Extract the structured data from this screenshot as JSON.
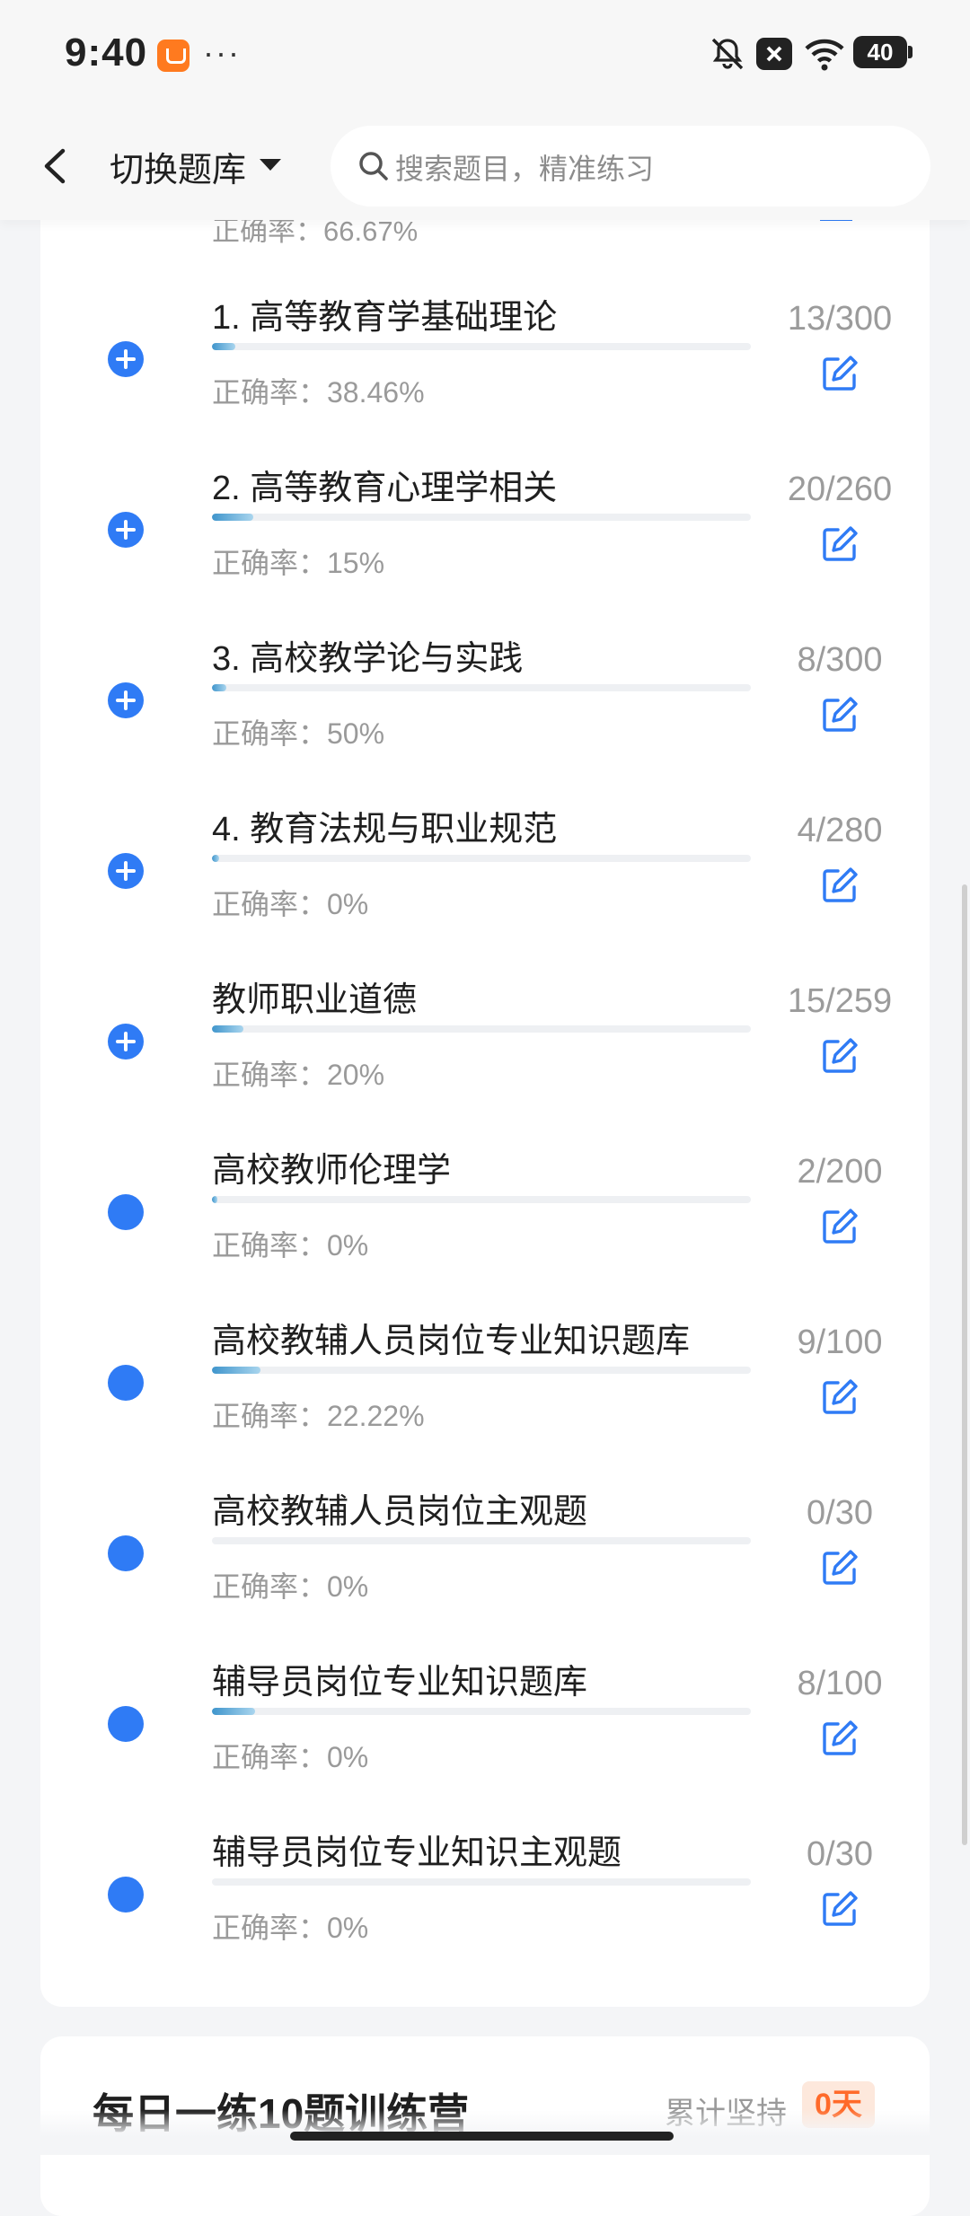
{
  "status": {
    "time": "9:40",
    "battery": "40"
  },
  "nav": {
    "switch_label": "切换题库",
    "search_placeholder": "搜索题目，精准练习"
  },
  "peek": {
    "accuracy_text": "正确率：66.67%"
  },
  "items": [
    {
      "title": "1. 高等教育学基础理论",
      "accuracy": "正确率：38.46%",
      "count": "13/300",
      "progress": 0.043,
      "icon": "plus"
    },
    {
      "title": "2. 高等教育心理学相关",
      "accuracy": "正确率：15%",
      "count": "20/260",
      "progress": 0.077,
      "icon": "plus"
    },
    {
      "title": "3. 高校教学论与实践",
      "accuracy": "正确率：50%",
      "count": "8/300",
      "progress": 0.027,
      "icon": "plus"
    },
    {
      "title": "4. 教育法规与职业规范",
      "accuracy": "正确率：0%",
      "count": "4/280",
      "progress": 0.014,
      "icon": "plus"
    },
    {
      "title": "教师职业道德",
      "accuracy": "正确率：20%",
      "count": "15/259",
      "progress": 0.058,
      "icon": "plus"
    },
    {
      "title": "高校教师伦理学",
      "accuracy": "正确率：0%",
      "count": "2/200",
      "progress": 0.01,
      "icon": "dot"
    },
    {
      "title": "高校教辅人员岗位专业知识题库",
      "accuracy": "正确率：22.22%",
      "count": "9/100",
      "progress": 0.09,
      "icon": "dot"
    },
    {
      "title": "高校教辅人员岗位主观题",
      "accuracy": "正确率：0%",
      "count": "0/30",
      "progress": 0.0,
      "icon": "dot"
    },
    {
      "title": "辅导员岗位专业知识题库",
      "accuracy": "正确率：0%",
      "count": "8/100",
      "progress": 0.08,
      "icon": "dot"
    },
    {
      "title": "辅导员岗位专业知识主观题",
      "accuracy": "正确率：0%",
      "count": "0/30",
      "progress": 0.0,
      "icon": "dot"
    }
  ],
  "camp": {
    "title": "每日一练10题训练营",
    "keep_label": "累计坚持",
    "days": "0天"
  },
  "colors": {
    "accent": "#2f7bf5",
    "days_badge": "#ff6a2a"
  }
}
